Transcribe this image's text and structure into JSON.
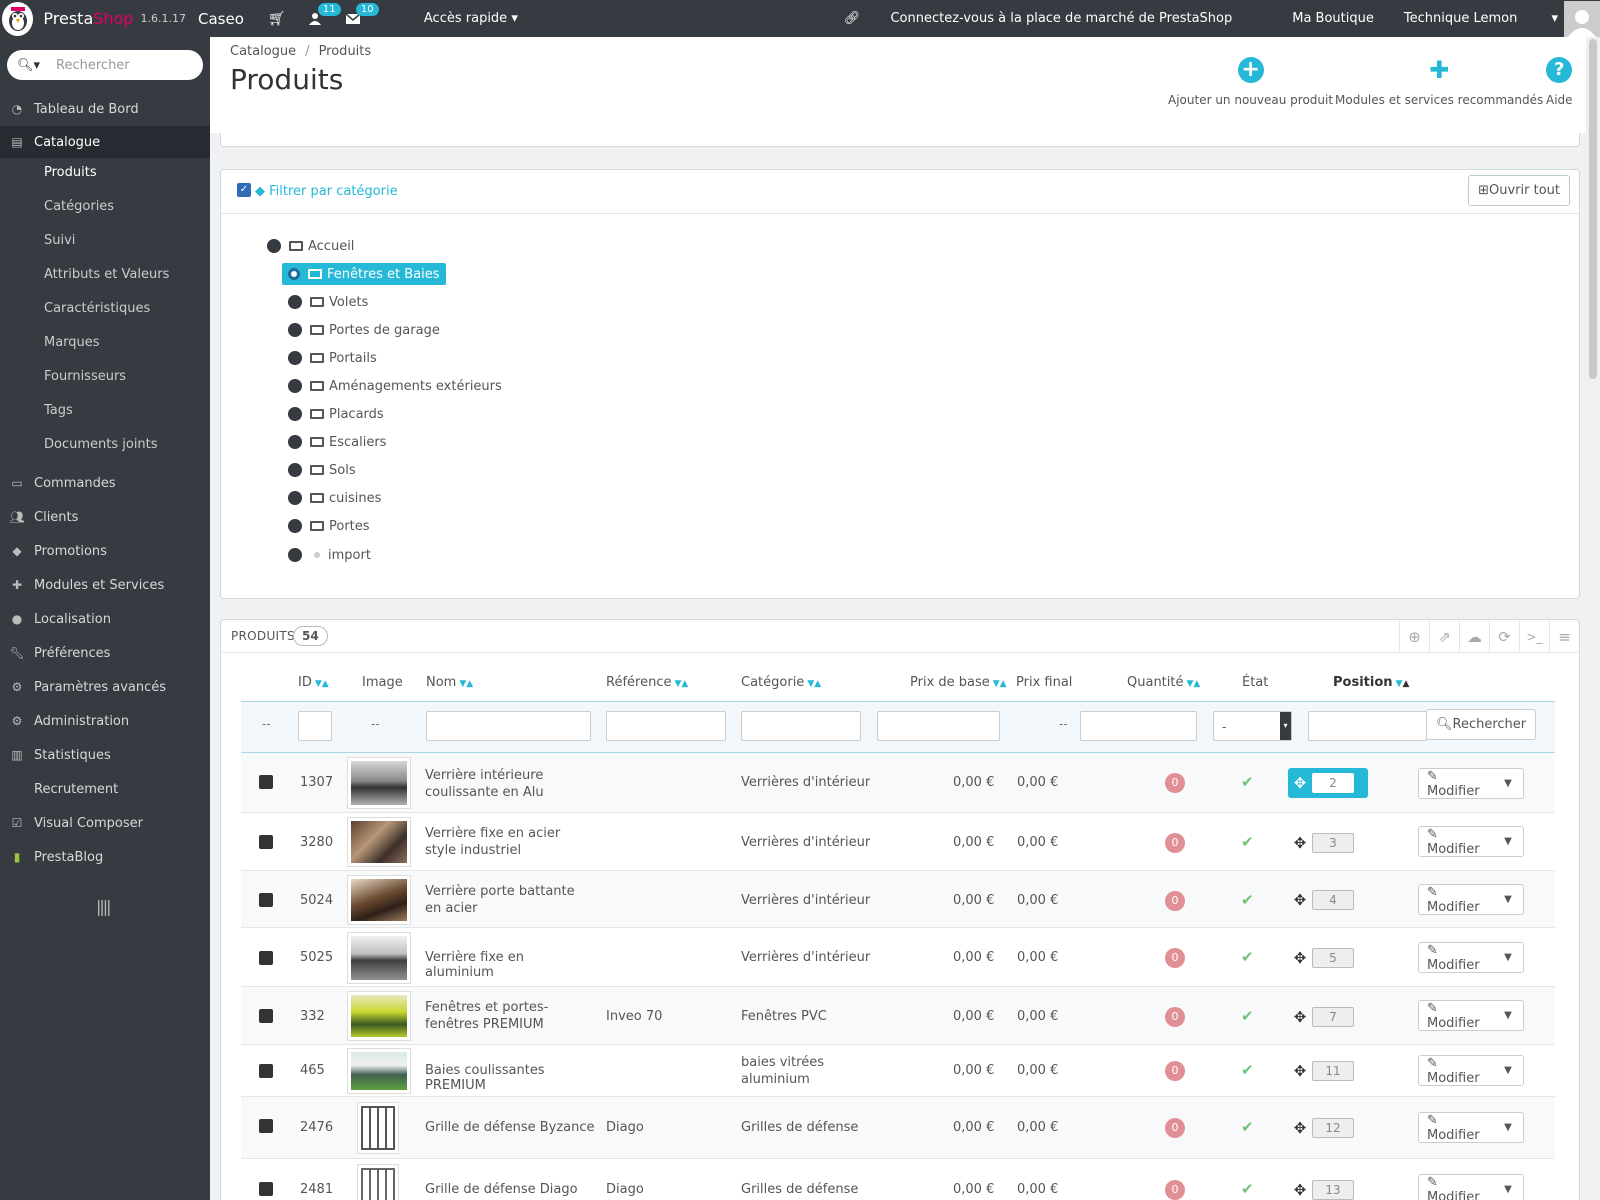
{
  "topbar": {
    "brand_prefix": "Presta",
    "brand_suffix": "Shop",
    "version": "1.6.1.17",
    "shop_name": "Caseo",
    "customers_badge": "11",
    "messages_badge": "10",
    "quick_access": "Accès rapide",
    "marketplace": "Connectez-vous à la place de marché de PrestaShop",
    "my_shop": "Ma Boutique",
    "user": "Technique Lemon"
  },
  "sidebar": {
    "search_placeholder": "Rechercher",
    "items": [
      {
        "label": "Tableau de Bord",
        "icon": "dashboard-icon"
      },
      {
        "label": "Catalogue",
        "icon": "book-icon"
      },
      {
        "label": "Commandes",
        "icon": "credit-card-icon"
      },
      {
        "label": "Clients",
        "icon": "users-icon"
      },
      {
        "label": "Promotions",
        "icon": "tags-icon"
      },
      {
        "label": "Modules et Services",
        "icon": "puzzle-icon"
      },
      {
        "label": "Localisation",
        "icon": "globe-icon"
      },
      {
        "label": "Préférences",
        "icon": "wrench-icon"
      },
      {
        "label": "Paramètres avancés",
        "icon": "cogs-icon"
      },
      {
        "label": "Administration",
        "icon": "gear-icon"
      },
      {
        "label": "Statistiques",
        "icon": "bar-chart-icon"
      },
      {
        "label": "Recrutement",
        "icon": ""
      },
      {
        "label": "Visual Composer",
        "icon": "check-square-icon"
      },
      {
        "label": "PrestaBlog",
        "icon": "document-icon"
      }
    ],
    "catalogue_sub": [
      "Produits",
      "Catégories",
      "Suivi",
      "Attributs et Valeurs",
      "Caractéristiques",
      "Marques",
      "Fournisseurs",
      "Tags",
      "Documents joints"
    ]
  },
  "header": {
    "breadcrumb": [
      "Catalogue",
      "Produits"
    ],
    "title": "Produits",
    "toolbar": [
      {
        "label": "Ajouter un nouveau produit",
        "icon": "plus-circle-icon"
      },
      {
        "label": "Modules et services recommandés",
        "icon": "puzzle-icon"
      },
      {
        "label": "Aide",
        "icon": "help-icon"
      }
    ]
  },
  "category_filter": {
    "title": "Filtrer par catégorie",
    "open_all": "Ouvrir tout",
    "root": "Accueil",
    "selected": "Fenêtres et Baies",
    "children": [
      "Volets",
      "Portes de garage",
      "Portails",
      "Aménagements extérieurs",
      "Placards",
      "Escaliers",
      "Sols",
      "cuisines",
      "Portes"
    ],
    "leaf": "import"
  },
  "products": {
    "title": "PRODUITS",
    "count": "54",
    "columns": [
      "ID",
      "Image",
      "Nom",
      "Référence",
      "Catégorie",
      "Prix de base",
      "Prix final",
      "Quantité",
      "État",
      "Position"
    ],
    "filter_dash": "--",
    "state_select": "-",
    "search_button": "Rechercher",
    "edit_label": "Modifier",
    "rows": [
      {
        "id": "1307",
        "name": "Verrière intérieure coulissante en Alu",
        "reference": "",
        "category": "Verrières d'intérieur",
        "base_price": "0,00 €",
        "final_price": "0,00 €",
        "quantity": "0",
        "position": "2"
      },
      {
        "id": "3280",
        "name": "Verrière fixe en acier style industriel",
        "reference": "",
        "category": "Verrières d'intérieur",
        "base_price": "0,00 €",
        "final_price": "0,00 €",
        "quantity": "0",
        "position": "3"
      },
      {
        "id": "5024",
        "name": "Verrière porte battante en acier",
        "reference": "",
        "category": "Verrières d'intérieur",
        "base_price": "0,00 €",
        "final_price": "0,00 €",
        "quantity": "0",
        "position": "4"
      },
      {
        "id": "5025",
        "name": "Verrière fixe en aluminium",
        "reference": "",
        "category": "Verrières d'intérieur",
        "base_price": "0,00 €",
        "final_price": "0,00 €",
        "quantity": "0",
        "position": "5"
      },
      {
        "id": "332",
        "name": "Fenêtres et portes-fenêtres PREMIUM",
        "reference": "Inveo 70",
        "category": "Fenêtres PVC",
        "base_price": "0,00 €",
        "final_price": "0,00 €",
        "quantity": "0",
        "position": "7"
      },
      {
        "id": "465",
        "name": "Baies coulissantes PREMIUM",
        "reference": "",
        "category": "baies vitrées aluminium",
        "base_price": "0,00 €",
        "final_price": "0,00 €",
        "quantity": "0",
        "position": "11"
      },
      {
        "id": "2476",
        "name": "Grille de défense Byzance",
        "reference": "Diago",
        "category": "Grilles de défense",
        "base_price": "0,00 €",
        "final_price": "0,00 €",
        "quantity": "0",
        "position": "12"
      },
      {
        "id": "2481",
        "name": "Grille de défense Diago",
        "reference": "Diago",
        "category": "Grilles de défense",
        "base_price": "0,00 €",
        "final_price": "0,00 €",
        "quantity": "0",
        "position": "13"
      }
    ]
  }
}
